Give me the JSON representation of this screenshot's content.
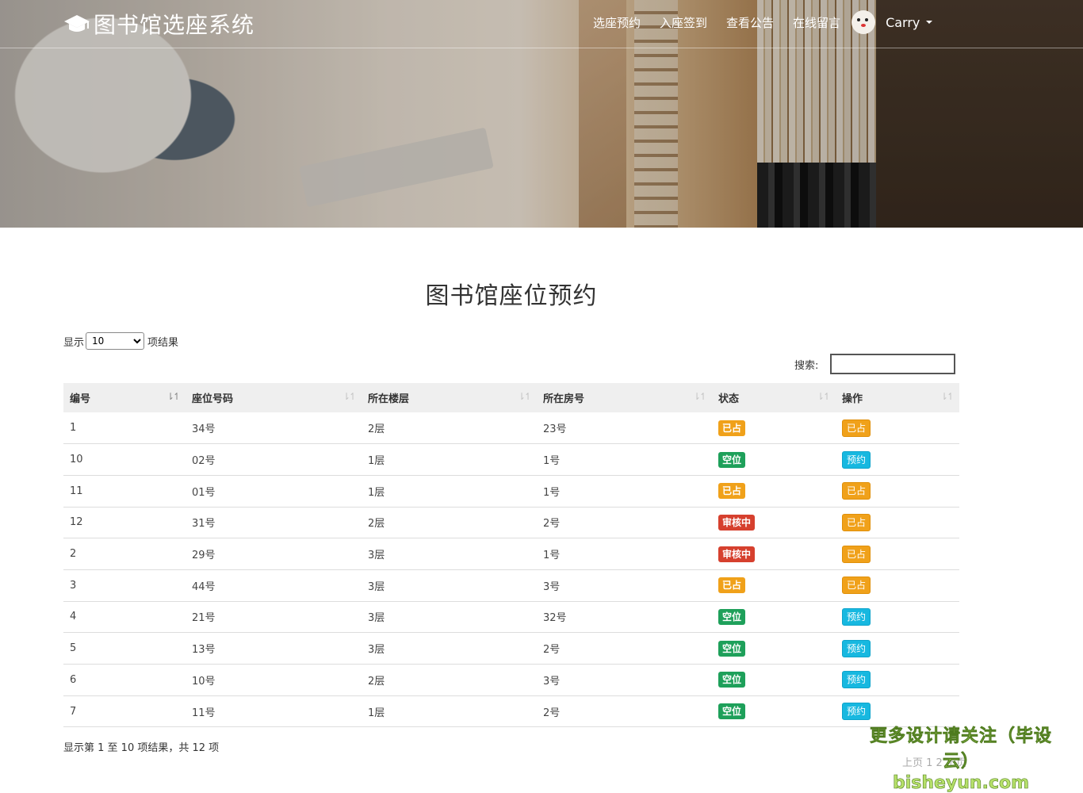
{
  "navbar": {
    "brand": "图书馆选座系统",
    "links": [
      "选座预约",
      "入座签到",
      "查看公告",
      "在线留言"
    ],
    "user_name": "Carry"
  },
  "page": {
    "title": "图书馆座位预约"
  },
  "controls": {
    "length_prefix": "显示",
    "length_value": "10",
    "length_suffix": "项结果",
    "search_label": "搜索:"
  },
  "table": {
    "columns": [
      "编号",
      "座位号码",
      "所在楼层",
      "所在房号",
      "状态",
      "操作"
    ],
    "rows": [
      {
        "id": "1",
        "seat": "34号",
        "floor": "2层",
        "room": "23号",
        "status": "已占",
        "action": "已占"
      },
      {
        "id": "10",
        "seat": "02号",
        "floor": "1层",
        "room": "1号",
        "status": "空位",
        "action": "预约"
      },
      {
        "id": "11",
        "seat": "01号",
        "floor": "1层",
        "room": "1号",
        "status": "已占",
        "action": "已占"
      },
      {
        "id": "12",
        "seat": "31号",
        "floor": "2层",
        "room": "2号",
        "status": "审核中",
        "action": "已占"
      },
      {
        "id": "2",
        "seat": "29号",
        "floor": "3层",
        "room": "1号",
        "status": "审核中",
        "action": "已占"
      },
      {
        "id": "3",
        "seat": "44号",
        "floor": "3层",
        "room": "3号",
        "status": "已占",
        "action": "已占"
      },
      {
        "id": "4",
        "seat": "21号",
        "floor": "3层",
        "room": "32号",
        "status": "空位",
        "action": "预约"
      },
      {
        "id": "5",
        "seat": "13号",
        "floor": "3层",
        "room": "2号",
        "status": "空位",
        "action": "预约"
      },
      {
        "id": "6",
        "seat": "10号",
        "floor": "2层",
        "room": "3号",
        "status": "空位",
        "action": "预约"
      },
      {
        "id": "7",
        "seat": "11号",
        "floor": "1层",
        "room": "2号",
        "status": "空位",
        "action": "预约"
      }
    ],
    "info": "显示第 1 至 10 项结果，共 12 项"
  },
  "watermark": {
    "line1": "更多设计请关注（毕设云）",
    "line2": "bisheyun.com"
  },
  "colors": {
    "occupied": "#f0a11a",
    "free": "#1ea05a",
    "review": "#d6402e",
    "book": "#17b8e0"
  }
}
